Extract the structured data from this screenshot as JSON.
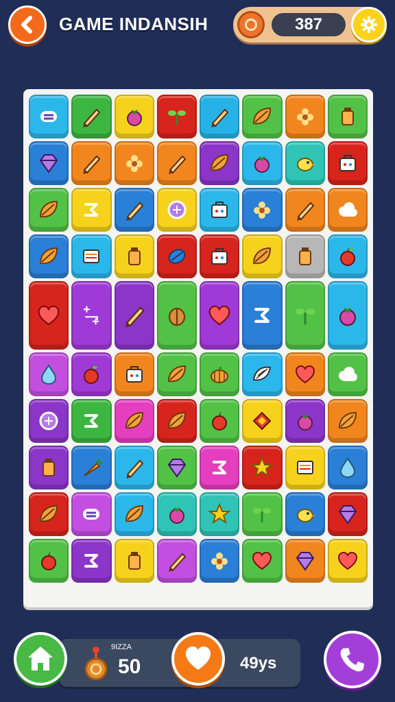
{
  "header": {
    "title": "GAME INDANSIH",
    "coins": "387",
    "back_icon": "chevron-left-icon",
    "coin_icon": "coin-icon",
    "settings_icon": "gear-icon"
  },
  "board": {
    "rows": [
      [
        {
          "icon": "lines",
          "color": "#2cb7ea"
        },
        {
          "icon": "pencil",
          "color": "#3cb641"
        },
        {
          "icon": "berry",
          "color": "#f7d21c"
        },
        {
          "icon": "sprout",
          "color": "#d7241c"
        },
        {
          "icon": "pencil",
          "color": "#27b2e6"
        },
        {
          "icon": "leaf",
          "color": "#52c246"
        },
        {
          "icon": "flower",
          "color": "#f2861e"
        },
        {
          "icon": "jar",
          "color": "#52c246"
        }
      ],
      [
        {
          "icon": "gem",
          "color": "#2a7fd6"
        },
        {
          "icon": "pencil",
          "color": "#f2861e"
        },
        {
          "icon": "flower",
          "color": "#f2861e"
        },
        {
          "icon": "pencil",
          "color": "#f2861e"
        },
        {
          "icon": "leaf",
          "color": "#8b35c9"
        },
        {
          "icon": "berry",
          "color": "#2cb7ea"
        },
        {
          "icon": "bird",
          "color": "#2fc4b6"
        },
        {
          "icon": "bag",
          "color": "#d7241c"
        }
      ],
      [
        {
          "icon": "leaf",
          "color": "#52c246"
        },
        {
          "icon": "swirl",
          "color": "#f7d21c"
        },
        {
          "icon": "pencil",
          "color": "#2a7fd6"
        },
        {
          "icon": "circle",
          "color": "#f7d21c"
        },
        {
          "icon": "bag",
          "color": "#2cb7ea"
        },
        {
          "icon": "flower",
          "color": "#2a7fd6"
        },
        {
          "icon": "pencil",
          "color": "#f2861e"
        },
        {
          "icon": "cloud",
          "color": "#f2861e"
        }
      ],
      [
        {
          "icon": "leaf",
          "color": "#2a7fd6"
        },
        {
          "icon": "box",
          "color": "#2cb7ea"
        },
        {
          "icon": "jar",
          "color": "#f7d21c"
        },
        {
          "icon": "ball",
          "color": "#d7241c"
        },
        {
          "icon": "bag",
          "color": "#d7241c"
        },
        {
          "icon": "leaf",
          "color": "#f7d21c"
        },
        {
          "icon": "jar",
          "color": "#b7b7b7"
        },
        {
          "icon": "apple",
          "color": "#2cb7ea"
        }
      ],
      [
        {
          "icon": "heart",
          "color": "#d7241c"
        },
        {
          "icon": "sparkle",
          "color": "#a03ad6"
        },
        {
          "icon": "pencil",
          "color": "#8b35c9"
        },
        {
          "icon": "nut",
          "color": "#52c246"
        },
        {
          "icon": "heart",
          "color": "#a03ad6"
        },
        {
          "icon": "swirl",
          "color": "#2a7fd6"
        },
        {
          "icon": "sprout",
          "color": "#52c246"
        },
        {
          "icon": "berry",
          "color": "#2cb7ea"
        }
      ],
      [
        {
          "icon": "drop",
          "color": "#c34fe0"
        },
        {
          "icon": "apple",
          "color": "#a03ad6"
        },
        {
          "icon": "bag",
          "color": "#f2861e"
        },
        {
          "icon": "leaf",
          "color": "#52c246"
        },
        {
          "icon": "pumpkin",
          "color": "#52c246"
        },
        {
          "icon": "shell",
          "color": "#2cb7ea"
        },
        {
          "icon": "heart",
          "color": "#f2861e"
        },
        {
          "icon": "cloud",
          "color": "#52c246"
        }
      ],
      [
        {
          "icon": "circle",
          "color": "#8b35c9"
        },
        {
          "icon": "swirl",
          "color": "#3cb641"
        },
        {
          "icon": "leaf",
          "color": "#e53fbf"
        },
        {
          "icon": "leaf",
          "color": "#d7241c"
        },
        {
          "icon": "apple",
          "color": "#52c246"
        },
        {
          "icon": "diamond",
          "color": "#f7d21c"
        },
        {
          "icon": "berry",
          "color": "#8b35c9"
        },
        {
          "icon": "leaf",
          "color": "#f2861e"
        }
      ],
      [
        {
          "icon": "jar",
          "color": "#8b35c9"
        },
        {
          "icon": "carrot",
          "color": "#2a7fd6"
        },
        {
          "icon": "pencil",
          "color": "#2cb7ea"
        },
        {
          "icon": "gem",
          "color": "#52c246"
        },
        {
          "icon": "swirl",
          "color": "#e53fbf"
        },
        {
          "icon": "star",
          "color": "#d7241c"
        },
        {
          "icon": "box",
          "color": "#f7d21c"
        },
        {
          "icon": "drop",
          "color": "#2a7fd6"
        }
      ],
      [
        {
          "icon": "leaf",
          "color": "#d7241c"
        },
        {
          "icon": "lines",
          "color": "#c34fe0"
        },
        {
          "icon": "leaf",
          "color": "#2cb7ea"
        },
        {
          "icon": "berry",
          "color": "#2fc4b6"
        },
        {
          "icon": "star",
          "color": "#2fc4b6"
        },
        {
          "icon": "sprout",
          "color": "#52c246"
        },
        {
          "icon": "bird",
          "color": "#2a7fd6"
        },
        {
          "icon": "gem",
          "color": "#d7241c"
        }
      ],
      [
        {
          "icon": "apple",
          "color": "#52c246"
        },
        {
          "icon": "swirl",
          "color": "#8b35c9"
        },
        {
          "icon": "jar",
          "color": "#f7d21c"
        },
        {
          "icon": "pencil",
          "color": "#c34fe0"
        },
        {
          "icon": "flower",
          "color": "#2a7fd6"
        },
        {
          "icon": "heart",
          "color": "#52c246"
        },
        {
          "icon": "gem",
          "color": "#f2861e"
        },
        {
          "icon": "heart",
          "color": "#f7d21c"
        }
      ]
    ]
  },
  "footer": {
    "caption": "9IZZA",
    "score": "50",
    "time": "49ys",
    "home_icon": "home-icon",
    "medal_icon": "medal-icon",
    "heart_icon": "heart-icon",
    "call_icon": "phone-icon"
  }
}
